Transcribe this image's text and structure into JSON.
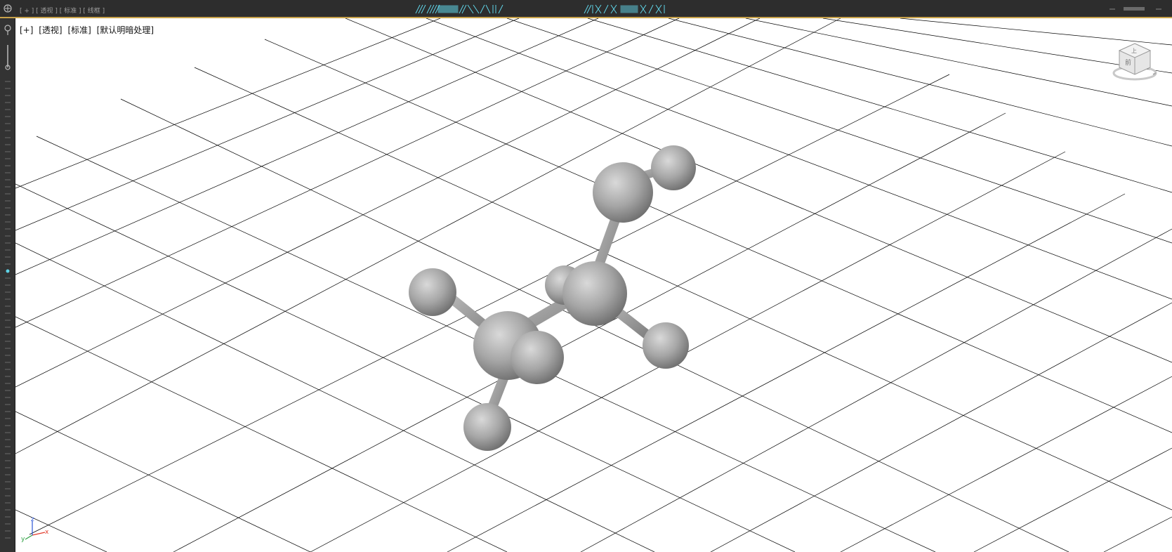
{
  "topbar": {
    "label": "[ + ] [ 透视 ] [ 标准 ] [ 线框 ]"
  },
  "viewport": {
    "menu": {
      "plus": "[+]",
      "view": "[透视]",
      "shading": "[标准]",
      "lighting": "[默认明暗处理]"
    },
    "axes": {
      "x": "x",
      "y": "y",
      "z": "z"
    },
    "viewcube_faces": {
      "front": "前",
      "top": "上"
    }
  },
  "colors": {
    "accent": "#c8a24a",
    "grid_line": "#000000",
    "sphere": "#a8a8a8",
    "background": "#ffffff",
    "topbar_strip": "#5fd3e6",
    "axis_x": "#e23a2a",
    "axis_y": "#2ea043",
    "axis_z": "#2a55d6"
  },
  "icons": {
    "app": "app-menu-icon",
    "viewcube": "viewcube-icon",
    "tripod": "axis-tripod-icon"
  }
}
